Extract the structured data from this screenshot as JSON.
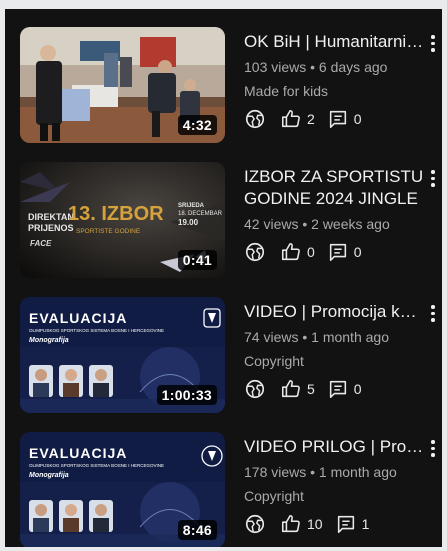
{
  "videos": [
    {
      "title": "OK BiH | Humanitarni koncert",
      "duration": "4:32",
      "meta": "103 views • 6 days ago",
      "tag": "Made for kids",
      "likes": "2",
      "comments": "0",
      "thumb": "event"
    },
    {
      "title": "IZBOR ZA SPORTISTU\nGODINE 2024 JINGLE",
      "duration": "0:41",
      "meta": "42 views • 2 weeks ago",
      "tag": "",
      "likes": "0",
      "comments": "0",
      "thumb": "izbor",
      "thumb_text": {
        "live1": "DIREKTAN",
        "live2": "PRIJENOS",
        "brand": "FACE",
        "num": "13. IZBOR",
        "sub": "SPORTISTE GODINE",
        "date1": "SRIJEDA",
        "date2": "18. DECEMBAR",
        "date3": "19.00"
      }
    },
    {
      "title": "VIDEO | Promocija knjige",
      "duration": "1:00:33",
      "meta": "74 views • 1 month ago",
      "tag": "Copyright",
      "likes": "5",
      "comments": "0",
      "thumb": "eval",
      "thumb_text": {
        "head": "EVALUACIJA",
        "sub": "OLIMPIJSKOG SPORTSKOG SISTEMA BOSNE I HERCEGOVINE",
        "mono": "Monografija"
      }
    },
    {
      "title": "VIDEO PRILOG | Promocija",
      "duration": "8:46",
      "meta": "178 views • 1 month ago",
      "tag": "Copyright",
      "likes": "10",
      "comments": "1",
      "thumb": "eval",
      "thumb_text": {
        "head": "EVALUACIJA",
        "sub": "OLIMPIJSKOG SPORTSKOG SISTEMA BOSNE I HERCEGOVINE",
        "mono": "Monografija"
      }
    }
  ],
  "icons": {
    "visibility": "globe-icon",
    "likes": "thumbs-up-icon",
    "comments": "comment-icon",
    "more": "more-vertical-icon"
  },
  "colors": {
    "background": "#121212",
    "text": "#f1f1f1",
    "secondary": "#aaaaaa",
    "accent_gold": "#d6a23c"
  }
}
